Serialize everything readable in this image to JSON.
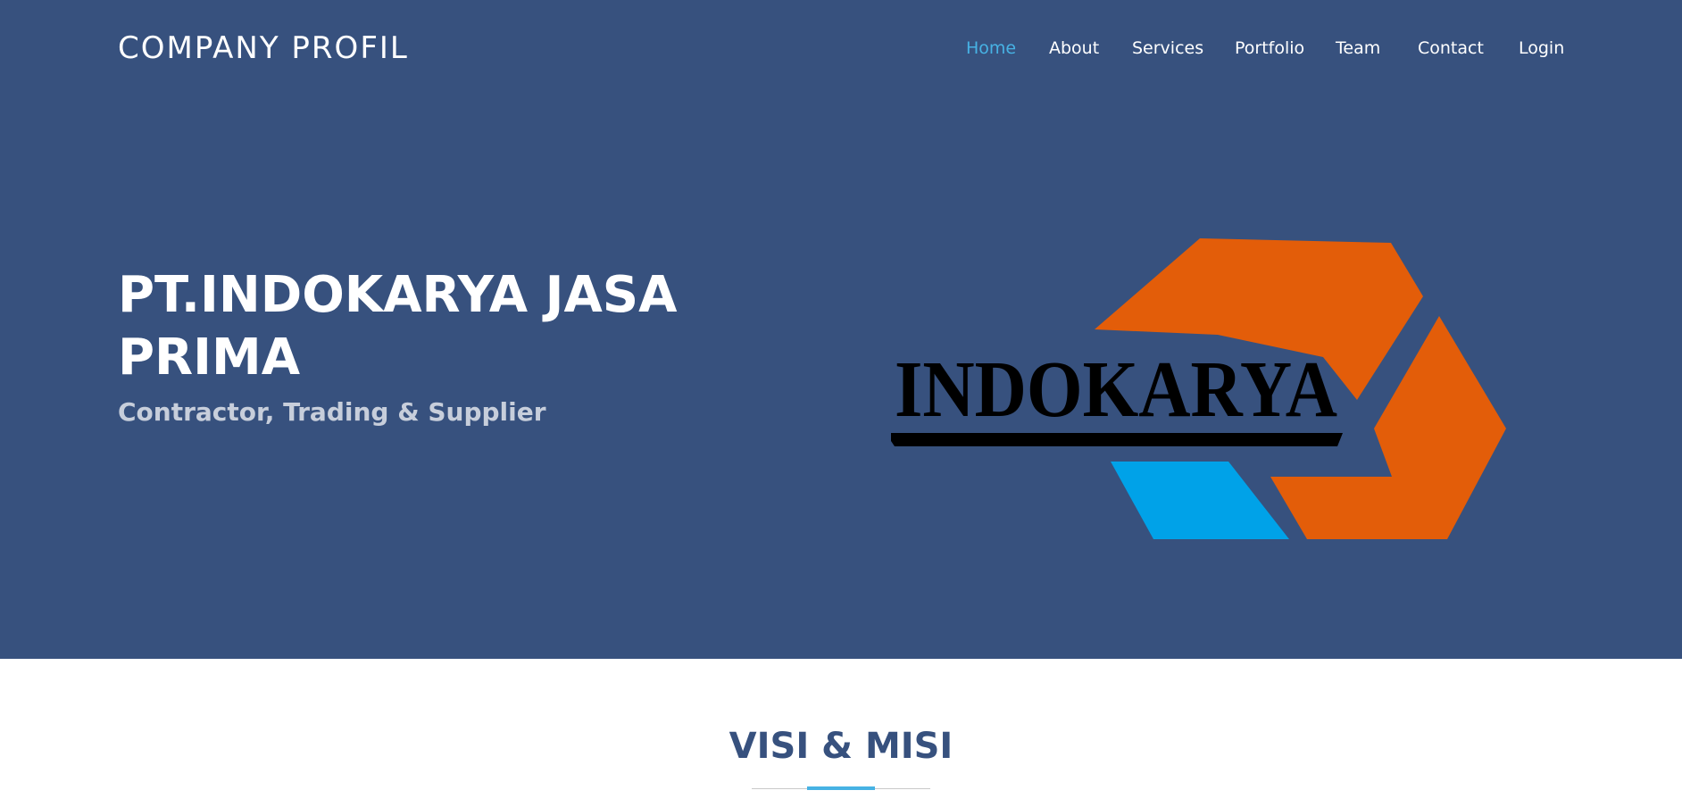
{
  "header": {
    "brand": "COMPANY PROFIL",
    "nav": [
      {
        "label": "Home",
        "active": true
      },
      {
        "label": "About"
      },
      {
        "label": "Services"
      },
      {
        "label": "Portfolio"
      },
      {
        "label": "Team"
      },
      {
        "label": "Contact"
      },
      {
        "label": "Login"
      }
    ]
  },
  "hero": {
    "title": "PT.INDOKARYA JASA PRIMA",
    "subtitle": "Contractor, Trading & Supplier",
    "logo": {
      "text": "INDOKARYA",
      "icon": "indokarya-logo"
    }
  },
  "section": {
    "title": "VISI & MISI"
  },
  "colors": {
    "hero_bg": "#37517e",
    "accent": "#47b2e4",
    "logo_orange": "#e35d09",
    "logo_blue": "#00a2e8",
    "logo_black": "#000000"
  }
}
